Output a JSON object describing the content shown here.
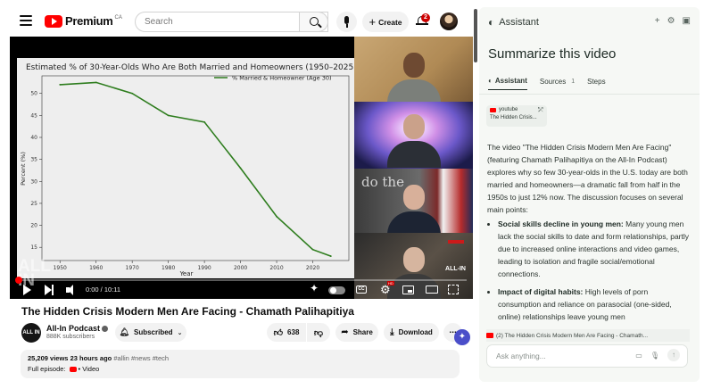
{
  "topbar": {
    "logo_text": "Premium",
    "logo_country": "CA",
    "search_placeholder": "Search",
    "create_label": "Create",
    "notification_count": "2"
  },
  "player": {
    "time_display": "0:00 / 10:11",
    "progress_fraction": 0.0,
    "watermark": "ALL IN",
    "tile3_text": "do the",
    "tile4_brand": "ALL-IN"
  },
  "chart_data": {
    "type": "line",
    "title": "Estimated % of 30-Year-Olds Who Are Both Married and Homeowners (1950–2025)",
    "xlabel": "Year",
    "ylabel": "Percent (%)",
    "legend_label": "% Married & Homeowner (Age 30)",
    "legend_position": "top-right",
    "grid": false,
    "xlim": [
      1945,
      2030
    ],
    "ylim": [
      12,
      54
    ],
    "x_ticks": [
      1950,
      1960,
      1970,
      1980,
      1990,
      2000,
      2010,
      2020
    ],
    "y_ticks": [
      15,
      20,
      25,
      30,
      35,
      40,
      45,
      50
    ],
    "series": [
      {
        "name": "% Married & Homeowner (Age 30)",
        "color": "#2e7d1e",
        "x": [
          1950,
          1960,
          1970,
          1980,
          1990,
          2000,
          2010,
          2020,
          2025
        ],
        "y": [
          52,
          52.5,
          50,
          45,
          43.5,
          33,
          22,
          14.5,
          13
        ]
      }
    ]
  },
  "video": {
    "title": "The Hidden Crisis Modern Men Are Facing - Chamath Palihapitiya",
    "channel_avatar_text": "ALL IN",
    "channel_name": "All-In Podcast",
    "subscribers": "888K subscribers",
    "subscribed_label": "Subscribed",
    "like_count": "638",
    "share_label": "Share",
    "download_label": "Download",
    "views": "25,209 views",
    "age": "23 hours ago",
    "tags": "#allin #news #tech",
    "full_episode_label": "Full episode:",
    "full_episode_link": "• Video"
  },
  "assistant": {
    "header_title": "Assistant",
    "page_title": "Summarize this video",
    "tabs": [
      {
        "label": "Assistant"
      },
      {
        "label": "Sources",
        "count": "1"
      },
      {
        "label": "Steps"
      }
    ],
    "source_card": {
      "site": "youtube",
      "title": "The Hidden Crisis..."
    },
    "intro": "The video \"The Hidden Crisis Modern Men Are Facing\" (featuring Chamath Palihapitiya on the All-In Podcast) explores why so few 30-year-olds in the U.S. today are both married and homeowners—a dramatic fall from half in the 1950s to just 12% now. The discussion focuses on several main points:",
    "bullets": [
      {
        "heading": "Social skills decline in young men:",
        "text": " Many young men lack the social skills to date and form relationships, partly due to increased online interactions and video games, leading to isolation and fragile social/emotional connections."
      },
      {
        "heading": "Impact of digital habits:",
        "text": " High levels of porn consumption and reliance on parasocial (one-sided, online) relationships leave young men"
      }
    ],
    "reference_text": "(2) The Hidden Crisis Modern Men Are Facing - Chamath...",
    "input_placeholder": "Ask anything..."
  }
}
